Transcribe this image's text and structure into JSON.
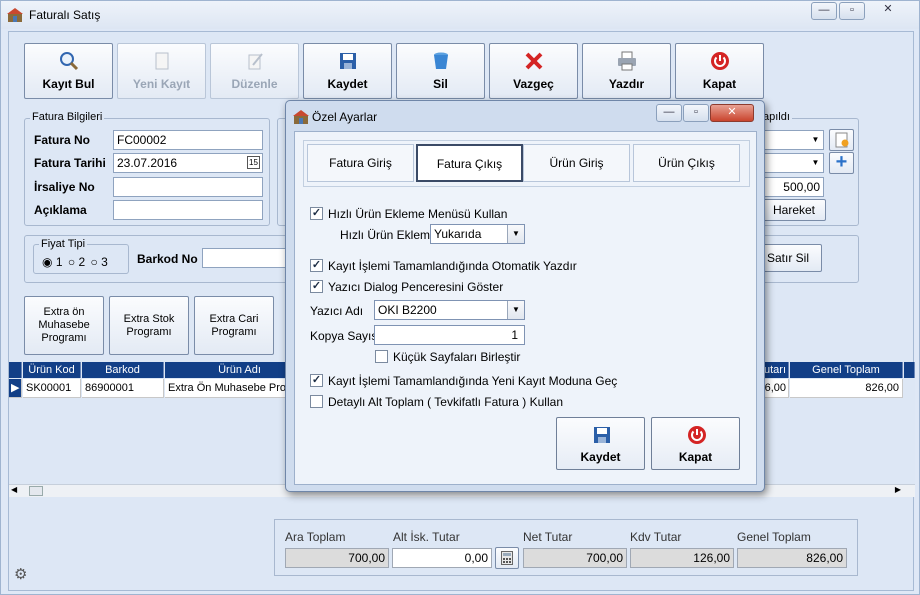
{
  "window": {
    "title": "Faturalı Satış"
  },
  "toolbar": {
    "kayit_bul": "Kayıt Bul",
    "yeni_kayit": "Yeni Kayıt",
    "duzenle": "Düzenle",
    "kaydet": "Kaydet",
    "sil": "Sil",
    "vazgec": "Vazgeç",
    "yazdir": "Yazdır",
    "kapat": "Kapat"
  },
  "fatura": {
    "group_label": "Fatura Bilgileri",
    "no_label": "Fatura No",
    "no_value": "FC00002",
    "tarih_label": "Fatura Tarihi",
    "tarih_value": "23.07.2016",
    "irsaliye_label": "İrsaliye No",
    "irsaliye_value": "",
    "aciklama_label": "Açıklama",
    "aciklama_value": ""
  },
  "right_panel": {
    "group_label_tail": "apıldı",
    "amount": "500,00",
    "hareket_btn": "Hareket",
    "satir_sil_btn": "Satır Sil"
  },
  "fiyat": {
    "group_label": "Fiyat Tipi",
    "options": [
      "1",
      "2",
      "3"
    ],
    "selected": "1",
    "barkod_label": "Barkod No"
  },
  "extra": {
    "muhasebe": "Extra ön Muhasebe Programı",
    "stok": "Extra Stok Programı",
    "cari": "Extra Cari Programı"
  },
  "grid": {
    "headers": [
      "Ürün Kod",
      "Barkod",
      "Ürün Adı",
      "utarı",
      "Genel Toplam"
    ],
    "row": {
      "kod": "SK00001",
      "barkod": "86900001",
      "ad": "Extra Ön Muhasebe Prog",
      "tutar": "6,00",
      "genel": "826,00"
    }
  },
  "totals": {
    "ara_label": "Ara Toplam",
    "ara": "700,00",
    "alt_label": "Alt İsk. Tutar",
    "alt": "0,00",
    "net_label": "Net Tutar",
    "net": "700,00",
    "kdv_label": "Kdv Tutar",
    "kdv": "126,00",
    "genel_label": "Genel Toplam",
    "genel": "826,00"
  },
  "dialog": {
    "title": "Özel Ayarlar",
    "tabs": [
      "Fatura Giriş",
      "Fatura Çıkış",
      "Ürün Giriş",
      "Ürün Çıkış"
    ],
    "selected_tab": "Fatura Çıkış",
    "hizli_menu": "Hızlı Ürün Ekleme Menüsü Kullan",
    "hizli_ekleme_label": "Hızlı Ürün Ekleme",
    "hizli_ekleme_value": "Yukarıda",
    "otomatik_yazdir": "Kayıt İşlemi Tamamlandığında Otomatik Yazdır",
    "yazici_dialog": "Yazıcı Dialog Penceresini Göster",
    "yazici_adi_label": "Yazıcı Adı",
    "yazici_adi_value": "OKI B2200",
    "kopya_label": "Kopya Sayısı",
    "kopya_value": "1",
    "kucuk_sayfa": "Küçük Sayfaları Birleştir",
    "yeni_kayit_modu": "Kayıt İşlemi Tamamlandığında Yeni Kayıt Moduna Geç",
    "detayli_alt": "Detaylı Alt Toplam ( Tevkifatlı Fatura ) Kullan",
    "kaydet": "Kaydet",
    "kapat": "Kapat"
  },
  "colors": {
    "accent": "#123f87",
    "background": "#dde7f5"
  }
}
